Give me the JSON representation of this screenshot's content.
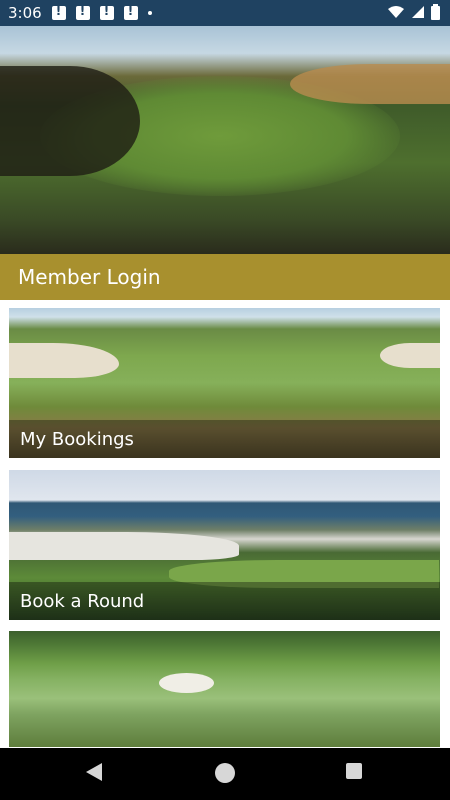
{
  "status_bar": {
    "time": "3:06"
  },
  "menu": {
    "member_login": "Member Login"
  },
  "cards": [
    {
      "label": "My Bookings"
    },
    {
      "label": "Book a Round"
    },
    {
      "label": ""
    }
  ],
  "icons": {
    "notification": "notification-icon",
    "wifi": "wifi-icon",
    "signal": "signal-icon",
    "battery": "battery-icon",
    "back": "back-icon",
    "home": "home-icon",
    "recent": "recent-apps-icon"
  },
  "colors": {
    "status_bar": "#1f4261",
    "accent": "#a8902e",
    "nav_bar": "#000000"
  }
}
